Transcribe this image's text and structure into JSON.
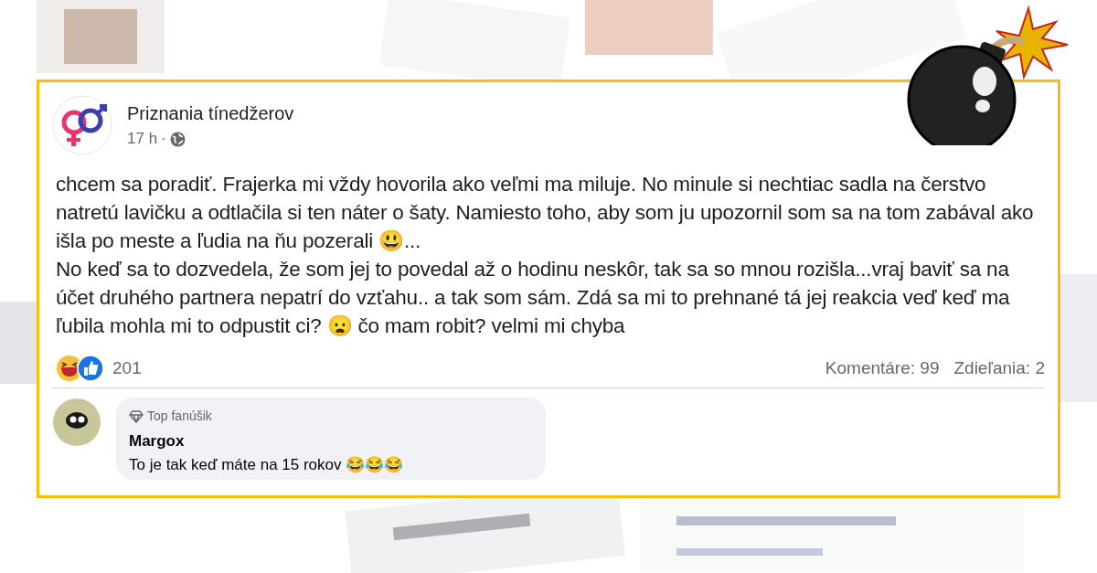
{
  "post": {
    "page_name": "Priznania tínedžerov",
    "time": "17 h",
    "separator": "·",
    "paragraphs": [
      "chcem sa poradiť. Frajerka mi vždy hovorila ako veľmi ma miluje. No minule si nechtiac sadla na čerstvo natretú lavičku a odtlačila si ten náter o šaty. Namiesto toho, aby som ju upozornil som sa na tom zabával ako išla po meste a ľudia na ňu pozerali 😃...",
      "No keď sa to dozvedela, že som jej to povedal až o hodinu neskôr, tak sa so mnou rozišla...vraj baviť sa na účet druhého partnera nepatrí do vzťahu.. a tak som sám. Zdá sa mi to prehnané tá jej reakcia veď keď ma ľubila mohla mi to odpustit ci? 😦 čo mam robit? velmi mi chyba"
    ],
    "reactions_count": "201",
    "comments": "Komentáre: 99",
    "shares": "Zdieľania: 2"
  },
  "comment": {
    "badge": "Top fanúšik",
    "author": "Margox",
    "text": "To je tak keď máte na 15 rokov 😂😂😂"
  }
}
